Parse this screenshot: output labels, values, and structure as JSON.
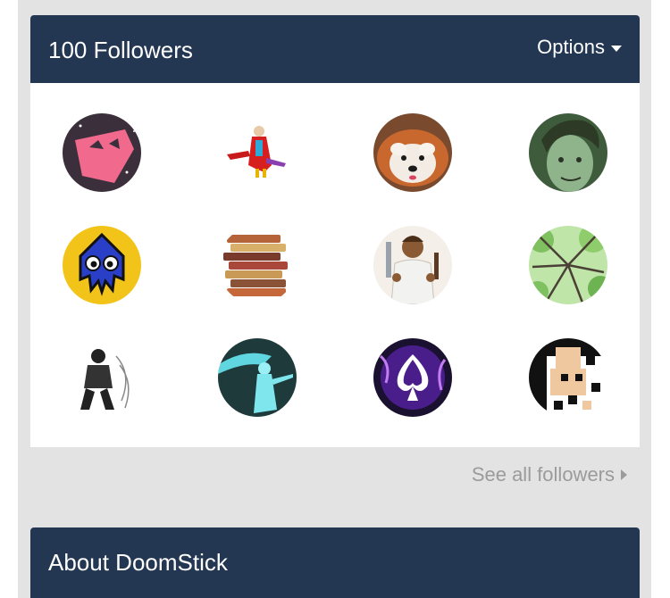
{
  "followers_panel": {
    "title": "100 Followers",
    "options_label": "Options",
    "see_all_label": "See all followers",
    "avatars": [
      "pink-cat-avatar",
      "red-robed-figure-avatar",
      "red-panda-avatar",
      "green-tinted-face-avatar",
      "blue-squid-avatar",
      "book-stack-avatar",
      "butcher-with-knife-avatar",
      "green-tree-canopy-avatar",
      "ink-sketch-figure-avatar",
      "glowing-ghost-woman-avatar",
      "purple-spade-avatar",
      "pixelated-face-avatar"
    ]
  },
  "about_panel": {
    "title": "About DoomStick"
  },
  "colors": {
    "header_bg": "#233652",
    "page_bg": "#e3e3e3",
    "muted_text": "#9b9b9b"
  }
}
